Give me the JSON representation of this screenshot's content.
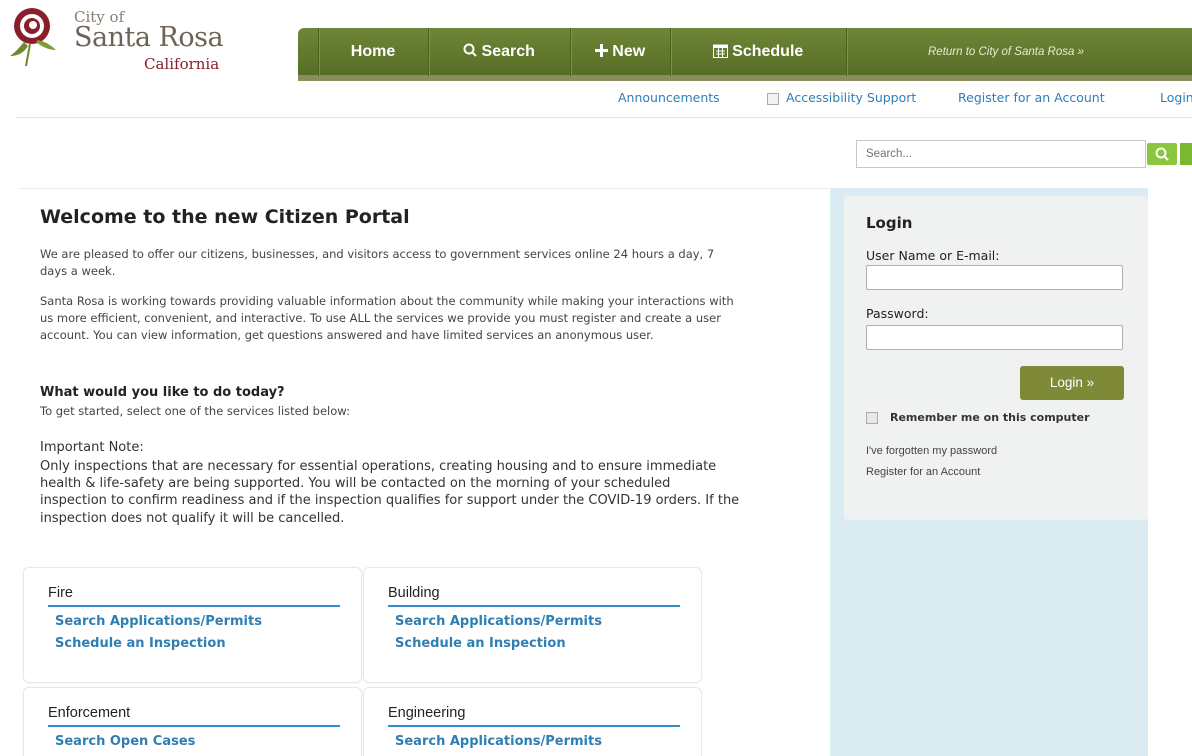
{
  "header": {
    "logo_city_of": "City of",
    "logo_name": "Santa Rosa",
    "logo_state": "California",
    "nav": [
      {
        "label": "Home",
        "icon": "none"
      },
      {
        "label": "Search",
        "icon": "search-icon"
      },
      {
        "label": "New",
        "icon": "plus-icon"
      },
      {
        "label": "Schedule",
        "icon": "calendar-icon"
      }
    ],
    "return_link": "Return to City of Santa Rosa »",
    "utility": {
      "announcements": "Announcements",
      "accessibility": "Accessibility Support",
      "register": "Register for an Account",
      "login": "Login"
    },
    "search_placeholder": "Search..."
  },
  "colors": {
    "nav_green": "#6f8637",
    "link_blue": "#2f7fb5",
    "login_button": "#7f8a39",
    "sidebar_bg": "#dbebf2",
    "search_button": "#8cc63f"
  },
  "main": {
    "title": "Welcome to the new Citizen Portal",
    "intro_1": "We are pleased to offer our citizens, businesses, and visitors access to government services online 24 hours a day, 7 days a week.",
    "intro_2": "Santa Rosa is working towards providing valuable information about the community while making your interactions with us more efficient, convenient, and interactive. To use ALL the services we provide you must register and create a user account. You can view information, get questions answered and have limited services an anonymous user.",
    "question": "What would you like to do today?",
    "question_sub": "To get started, select one of the services listed below:",
    "note_heading": "Important Note:",
    "note_body": "Only inspections that are necessary for essential operations, creating housing and to ensure immediate health & life-safety are being supported.  You will be contacted on the morning of your scheduled inspection to confirm readiness and if the inspection qualifies for support under the COVID-19 orders.  If the inspection does not qualify it will be cancelled.",
    "cards": [
      {
        "title": "Fire",
        "links": [
          "Search Applications/Permits",
          "Schedule an Inspection"
        ]
      },
      {
        "title": "Building",
        "links": [
          "Search Applications/Permits",
          "Schedule an Inspection"
        ]
      },
      {
        "title": "Enforcement",
        "links": [
          "Search Open Cases"
        ]
      },
      {
        "title": "Engineering",
        "links": [
          "Search Applications/Permits"
        ]
      }
    ]
  },
  "login": {
    "heading": "Login",
    "username_label": "User Name or E-mail:",
    "password_label": "Password:",
    "button": "Login »",
    "remember": "Remember me on this computer",
    "forgot": "I've forgotten my password",
    "register": "Register for an Account"
  }
}
